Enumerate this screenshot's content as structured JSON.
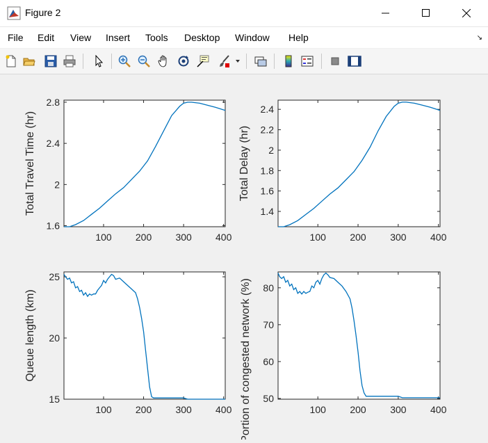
{
  "window": {
    "title": "Figure 2",
    "controls": [
      "minimize",
      "maximize",
      "close"
    ]
  },
  "menu": {
    "items": [
      "File",
      "Edit",
      "View",
      "Insert",
      "Tools",
      "Desktop",
      "Window",
      "Help"
    ]
  },
  "toolbar": {
    "buttons": [
      "new-figure-icon",
      "open-file-icon",
      "save-icon",
      "print-icon",
      "edit-plot-arrow-icon",
      "zoom-in-icon",
      "zoom-out-icon",
      "pan-hand-icon",
      "rotate-3d-icon",
      "data-cursor-icon",
      "brush-icon",
      "brush-dropdown-icon",
      "link-plot-icon",
      "colorbar-icon",
      "legend-icon",
      "hide-plot-tools-icon",
      "show-plot-tools-icon"
    ]
  },
  "colors": {
    "line": "#0072bd",
    "axes_bg": "#ffffff",
    "figure_bg": "#f0f0f0"
  },
  "chart_data": [
    {
      "type": "line",
      "ylabel": "Total Travel Time (hr)",
      "xlim": [
        1,
        404
      ],
      "ylim": [
        1.59,
        2.82
      ],
      "xticks": [
        "100",
        "200",
        "300",
        "400"
      ],
      "yticks": [
        "1.6",
        "2",
        "2.4",
        "2.8"
      ],
      "x": [
        1,
        15,
        30,
        50,
        70,
        90,
        110,
        130,
        150,
        170,
        190,
        210,
        230,
        250,
        270,
        290,
        300,
        310,
        320,
        340,
        360,
        380,
        404
      ],
      "y": [
        1.59,
        1.59,
        1.61,
        1.65,
        1.71,
        1.77,
        1.84,
        1.91,
        1.97,
        2.05,
        2.13,
        2.23,
        2.37,
        2.52,
        2.67,
        2.76,
        2.79,
        2.8,
        2.8,
        2.79,
        2.77,
        2.75,
        2.72
      ]
    },
    {
      "type": "line",
      "ylabel": "Total Delay (hr)",
      "xlim": [
        1,
        404
      ],
      "ylim": [
        1.25,
        2.49
      ],
      "xticks": [
        "100",
        "200",
        "300",
        "400"
      ],
      "yticks": [
        "1.4",
        "1.6",
        "1.8",
        "2",
        "2.2",
        "2.4"
      ],
      "x": [
        1,
        15,
        30,
        50,
        70,
        90,
        110,
        130,
        150,
        170,
        190,
        210,
        230,
        250,
        270,
        290,
        300,
        310,
        320,
        340,
        360,
        380,
        404
      ],
      "y": [
        1.25,
        1.25,
        1.27,
        1.31,
        1.37,
        1.43,
        1.5,
        1.57,
        1.63,
        1.71,
        1.79,
        1.9,
        2.03,
        2.19,
        2.33,
        2.43,
        2.46,
        2.47,
        2.47,
        2.46,
        2.44,
        2.42,
        2.39
      ]
    },
    {
      "type": "line",
      "ylabel": "Queue length (km)",
      "xlim": [
        1,
        404
      ],
      "ylim": [
        15,
        25.4
      ],
      "xticks": [
        "100",
        "200",
        "300",
        "400"
      ],
      "yticks": [
        "15",
        "20",
        "25"
      ],
      "x": [
        1,
        5,
        10,
        15,
        20,
        25,
        30,
        35,
        40,
        45,
        50,
        55,
        60,
        65,
        70,
        75,
        80,
        85,
        90,
        95,
        100,
        105,
        110,
        115,
        120,
        125,
        130,
        140,
        150,
        160,
        170,
        180,
        185,
        190,
        195,
        200,
        205,
        210,
        215,
        220,
        225,
        240,
        260,
        300,
        310,
        350,
        404
      ],
      "y": [
        25.2,
        25.0,
        24.8,
        24.9,
        24.5,
        24.6,
        24.1,
        24.2,
        23.8,
        23.9,
        23.5,
        23.7,
        23.4,
        23.6,
        23.5,
        23.6,
        23.6,
        23.9,
        24.1,
        24.3,
        24.7,
        24.5,
        24.8,
        25.0,
        25.2,
        25.1,
        24.8,
        24.9,
        24.6,
        24.3,
        24.0,
        23.7,
        23.2,
        22.5,
        21.6,
        20.5,
        19.0,
        17.5,
        16.0,
        15.2,
        15.1,
        15.1,
        15.1,
        15.1,
        15.0,
        15.0,
        15.0
      ]
    },
    {
      "type": "line",
      "ylabel": "Portion of congested network (%)",
      "xlim": [
        1,
        404
      ],
      "ylim": [
        49.8,
        84.3
      ],
      "xticks": [
        "100",
        "200",
        "300",
        "400"
      ],
      "yticks": [
        "50",
        "60",
        "70",
        "80"
      ],
      "x": [
        1,
        5,
        10,
        15,
        20,
        25,
        30,
        35,
        40,
        45,
        50,
        55,
        60,
        65,
        70,
        75,
        80,
        85,
        90,
        95,
        100,
        105,
        110,
        115,
        120,
        125,
        130,
        140,
        150,
        160,
        170,
        180,
        185,
        190,
        195,
        200,
        205,
        210,
        215,
        220,
        225,
        240,
        260,
        300,
        310,
        350,
        404
      ],
      "y": [
        84.0,
        83.0,
        82.5,
        83.0,
        81.5,
        82.0,
        80.5,
        81.0,
        79.5,
        80.0,
        78.5,
        79.0,
        78.3,
        79.0,
        78.5,
        78.8,
        79.0,
        80.5,
        80.0,
        81.5,
        82.0,
        81.0,
        82.5,
        83.5,
        84.0,
        83.5,
        82.8,
        82.5,
        81.5,
        80.5,
        79.0,
        77.0,
        74.5,
        71.0,
        67.0,
        62.5,
        57.5,
        53.5,
        51.5,
        50.6,
        50.6,
        50.6,
        50.6,
        50.6,
        50.2,
        50.2,
        50.2
      ]
    }
  ]
}
